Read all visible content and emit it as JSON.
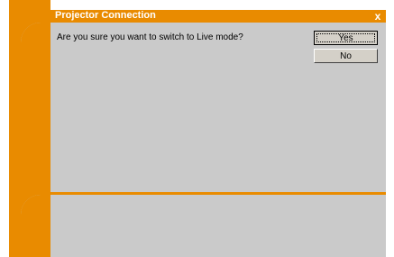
{
  "dialog": {
    "title": "Projector Connection",
    "close_symbol": "x",
    "message": "Are you sure you want to switch to Live mode?",
    "yes_label": "Yes",
    "no_label": "No"
  },
  "colors": {
    "accent": "#e98b00",
    "panel": "#cacaca",
    "button_face": "#d4d0c8"
  },
  "icons": {
    "close": "close-icon"
  }
}
